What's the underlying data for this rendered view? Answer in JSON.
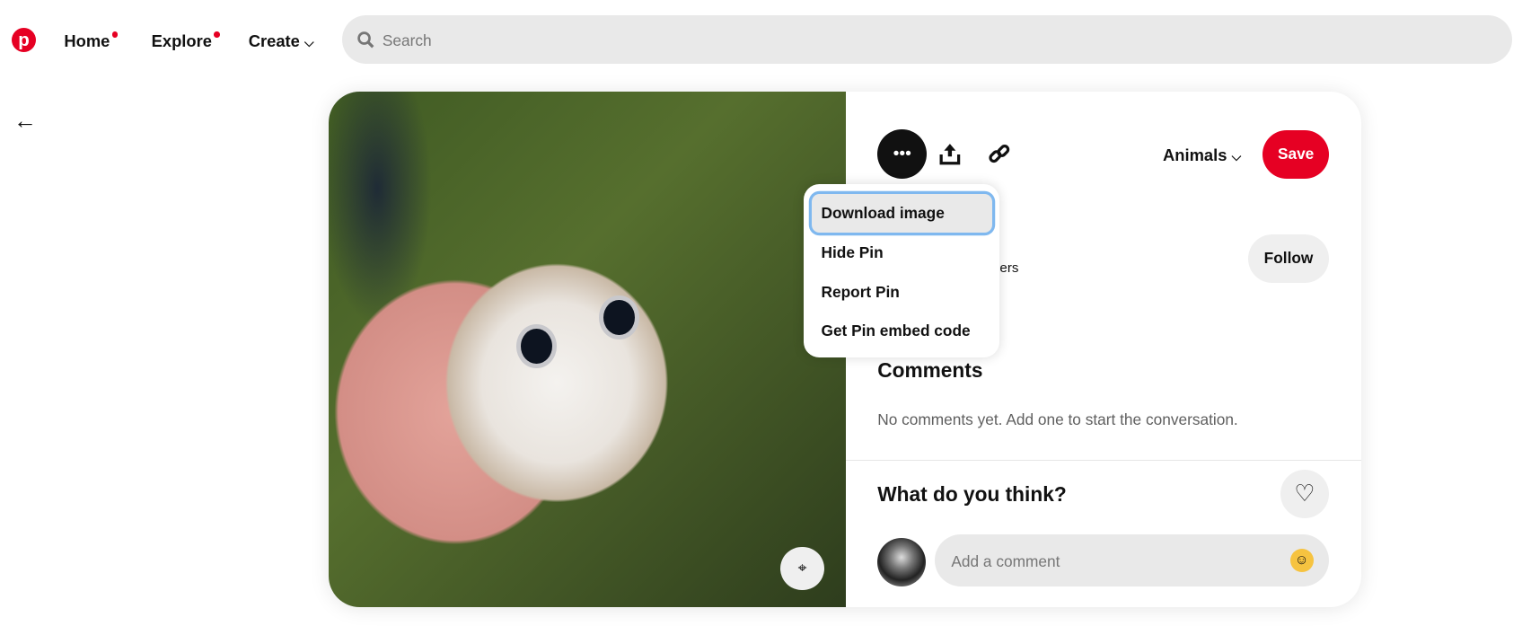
{
  "nav": {
    "home": "Home",
    "explore": "Explore",
    "create": "Create",
    "search_placeholder": "Search"
  },
  "pin": {
    "board": "Animals",
    "save": "Save",
    "follow": "Follow",
    "followers_partial": "ers",
    "comments_title": "Comments",
    "no_comments": "No comments yet. Add one to start the conversation.",
    "what_think": "What do you think?",
    "comment_placeholder": "Add a comment"
  },
  "menu": {
    "items": [
      "Download image",
      "Hide Pin",
      "Report Pin",
      "Get Pin embed code"
    ]
  },
  "colors": {
    "brand": "#e60023",
    "focus": "#7fb8ef"
  }
}
